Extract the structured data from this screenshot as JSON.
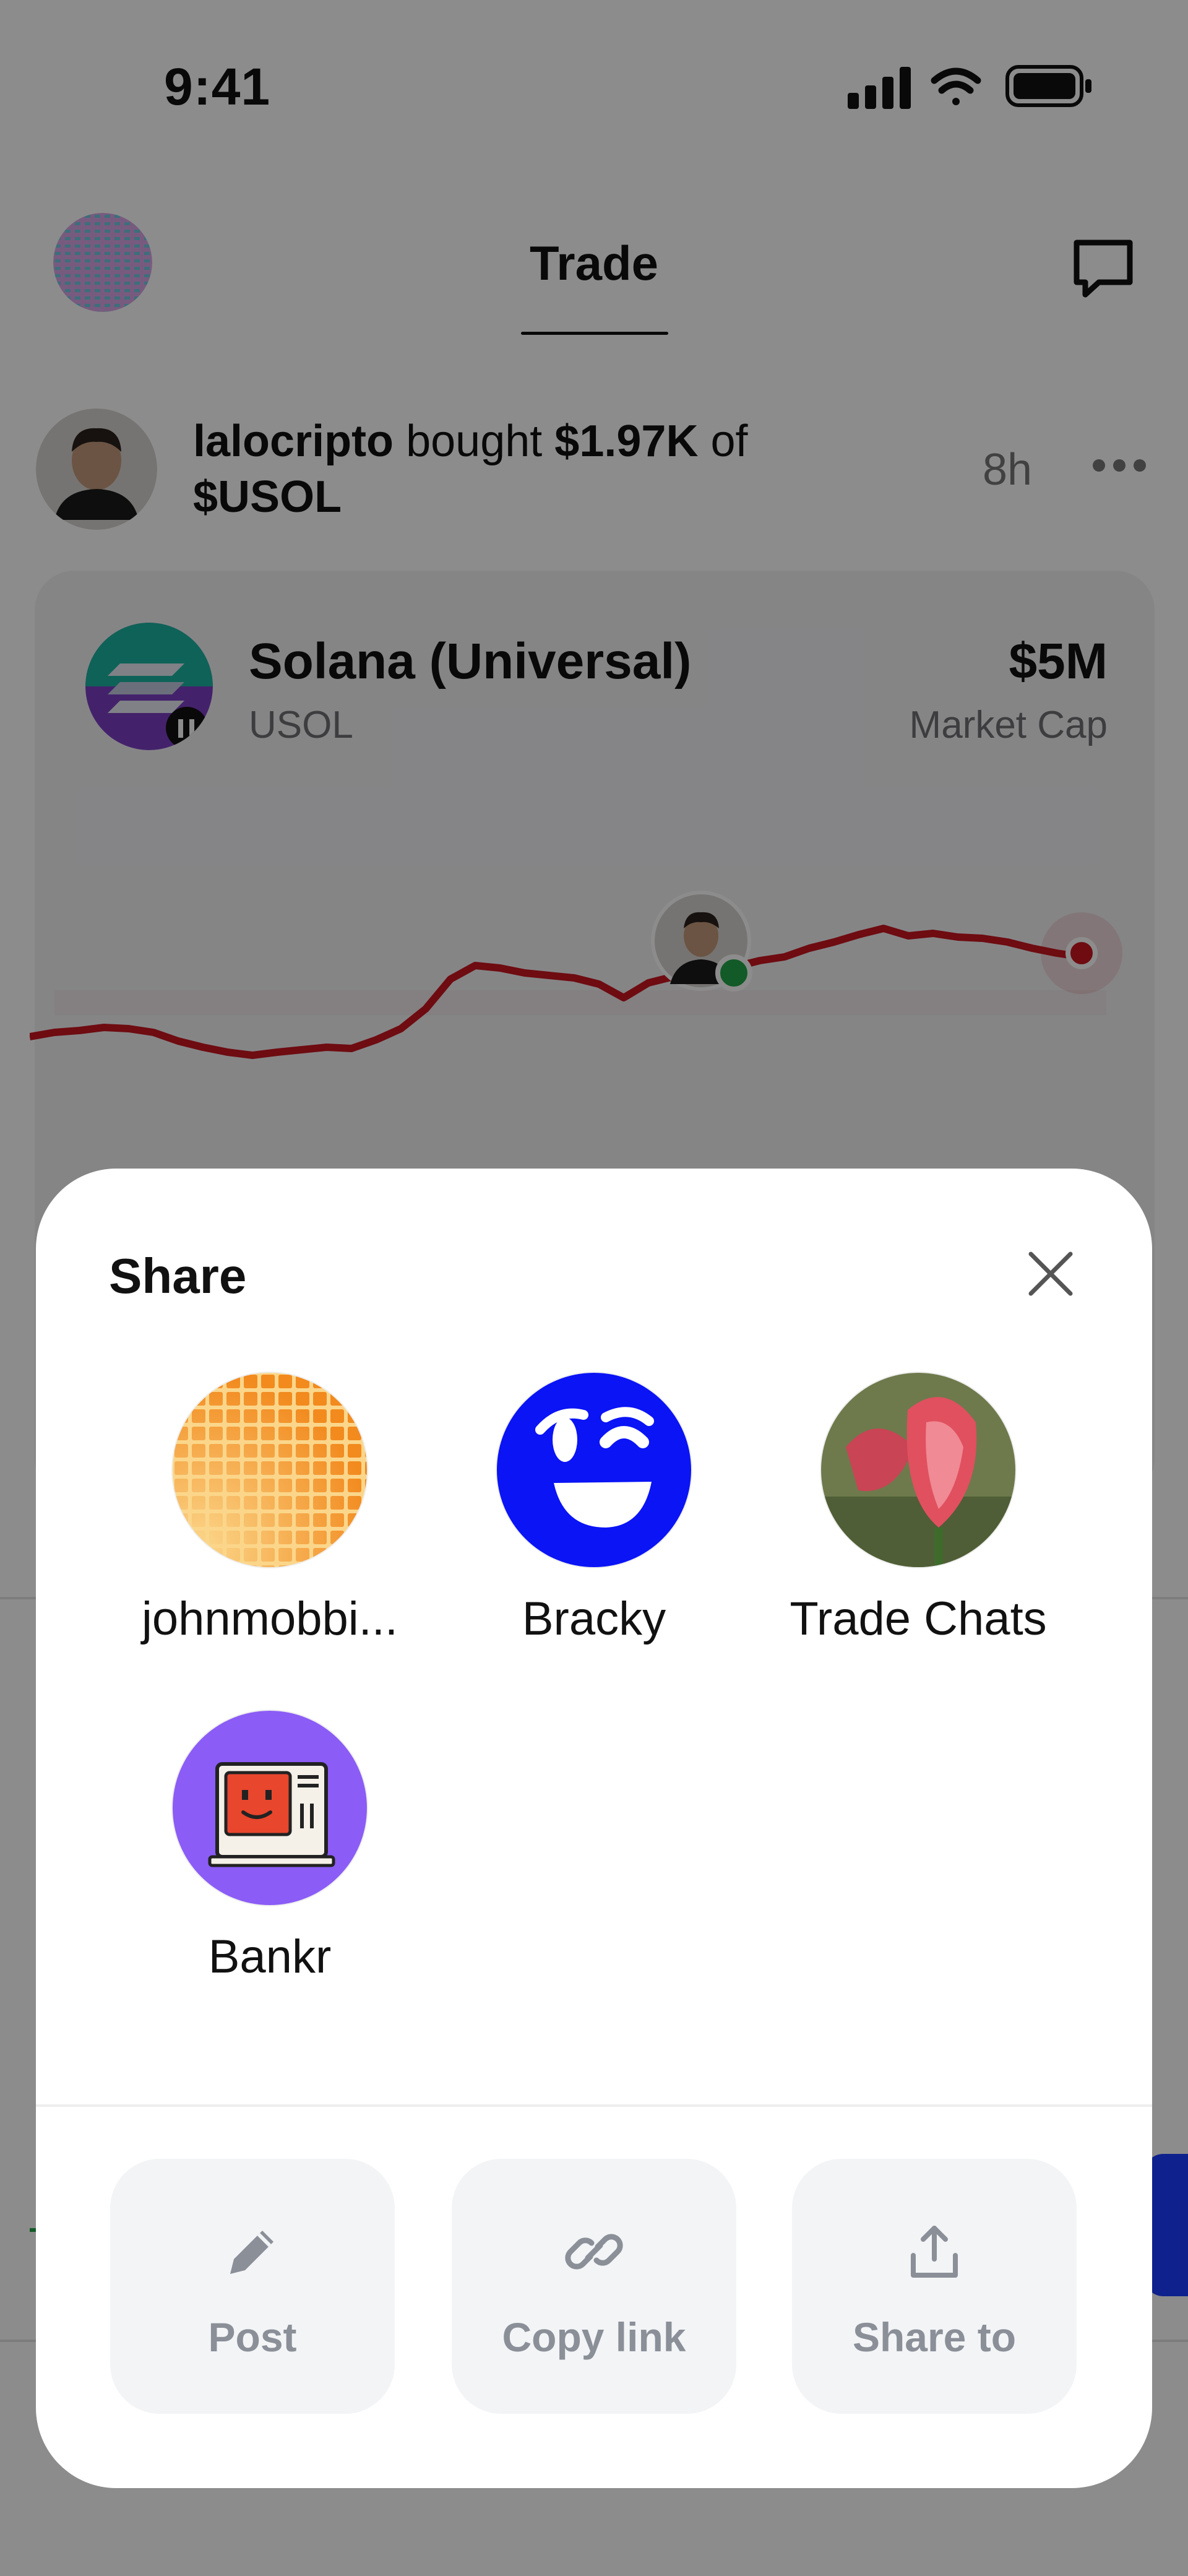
{
  "status_bar": {
    "time": "9:41"
  },
  "header": {
    "title": "Trade"
  },
  "feed_item": {
    "user": "lalocripto",
    "action": "bought",
    "amount": "$1.97K",
    "connector": "of",
    "token": "$USOL",
    "time": "8h"
  },
  "token_card": {
    "name": "Solana (Universal)",
    "ticker": "USOL",
    "market_cap": "$5M",
    "market_cap_label": "Market Cap"
  },
  "share_sheet": {
    "title": "Share",
    "targets": [
      {
        "label": "johnmobbi...",
        "icon": "orange-grid-avatar"
      },
      {
        "label": "Bracky",
        "icon": "wink-face-avatar"
      },
      {
        "label": "Trade Chats",
        "icon": "tulip-avatar"
      },
      {
        "label": "Bankr",
        "icon": "robot-terminal-avatar"
      }
    ],
    "actions": [
      {
        "label": "Post",
        "icon": "pencil-icon"
      },
      {
        "label": "Copy link",
        "icon": "link-icon"
      },
      {
        "label": "Share to",
        "icon": "share-upload-icon"
      }
    ]
  },
  "colors": {
    "chart_line": "#c8161f",
    "online_dot": "#22a447",
    "bracky_blue": "#0a14f5",
    "bankr_purple": "#8b5cf6",
    "scrim": "rgba(0,0,0,0.45)"
  }
}
